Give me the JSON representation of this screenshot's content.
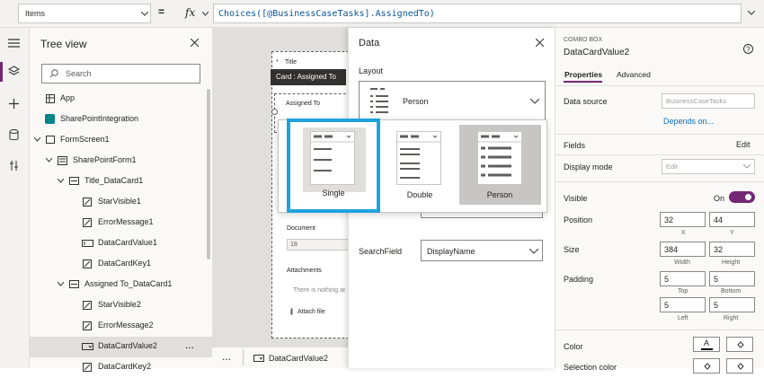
{
  "formula_bar": {
    "property": "Items",
    "equals": "=",
    "fx": "fx",
    "formula": "Choices([@BusinessCaseTasks].AssignedTo)"
  },
  "tree": {
    "title": "Tree view",
    "search_placeholder": "Search",
    "items": [
      {
        "label": "App"
      },
      {
        "label": "SharePointIntegration"
      },
      {
        "label": "FormScreen1"
      },
      {
        "label": "SharePointForm1"
      },
      {
        "label": "Title_DataCard1"
      },
      {
        "label": "StarVisible1"
      },
      {
        "label": "ErrorMessage1"
      },
      {
        "label": "DataCardValue1"
      },
      {
        "label": "DataCardKey1"
      },
      {
        "label": "Assigned To_DataCard1"
      },
      {
        "label": "StarVisible2"
      },
      {
        "label": "ErrorMessage2"
      },
      {
        "label": "DataCardValue2"
      },
      {
        "label": "DataCardKey2"
      }
    ],
    "more": "..."
  },
  "canvas": {
    "title_label": "Title",
    "card_tooltip": "Card : Assigned To",
    "assigned_label": "Assigned To",
    "document_label": "Document",
    "document_value": "18",
    "attachments_label": "Attachments",
    "attachments_empty": "There is nothing at",
    "attach_file": "Attach file"
  },
  "statusbar": {
    "dots": "...",
    "selected": "DataCardValue2"
  },
  "data_panel": {
    "title": "Data",
    "layout_label": "Layout",
    "layout_value": "Person",
    "options": [
      {
        "label": "Single",
        "selected": true
      },
      {
        "label": "Double",
        "selected": false
      },
      {
        "label": "Person",
        "selected": false
      }
    ],
    "search_field_label": "SearchField",
    "search_field_value": "DisplayName",
    "accent": "#1fa3dc"
  },
  "properties": {
    "type": "COMBO BOX",
    "name": "DataCardValue2",
    "tabs": [
      "Properties",
      "Advanced"
    ],
    "data_source_label": "Data source",
    "data_source_value": "BusinessCaseTasks",
    "depends_on": "Depends on...",
    "fields_label": "Fields",
    "fields_edit": "Edit",
    "display_mode_label": "Display mode",
    "display_mode_value": "Edit",
    "visible_label": "Visible",
    "visible_value": "On",
    "position_label": "Position",
    "pos_x": "32",
    "pos_y": "44",
    "x_label": "X",
    "y_label": "Y",
    "size_label": "Size",
    "width": "384",
    "height": "32",
    "width_label": "Width",
    "height_label": "Height",
    "padding_label": "Padding",
    "pad_top": "5",
    "pad_bottom": "5",
    "pad_left": "5",
    "pad_right": "5",
    "top_label": "Top",
    "bottom_label": "Bottom",
    "left_label": "Left",
    "right_label": "Right",
    "color_label": "Color",
    "color_letter": "A",
    "selection_color_label": "Selection color",
    "toggle_color": "#742774"
  }
}
